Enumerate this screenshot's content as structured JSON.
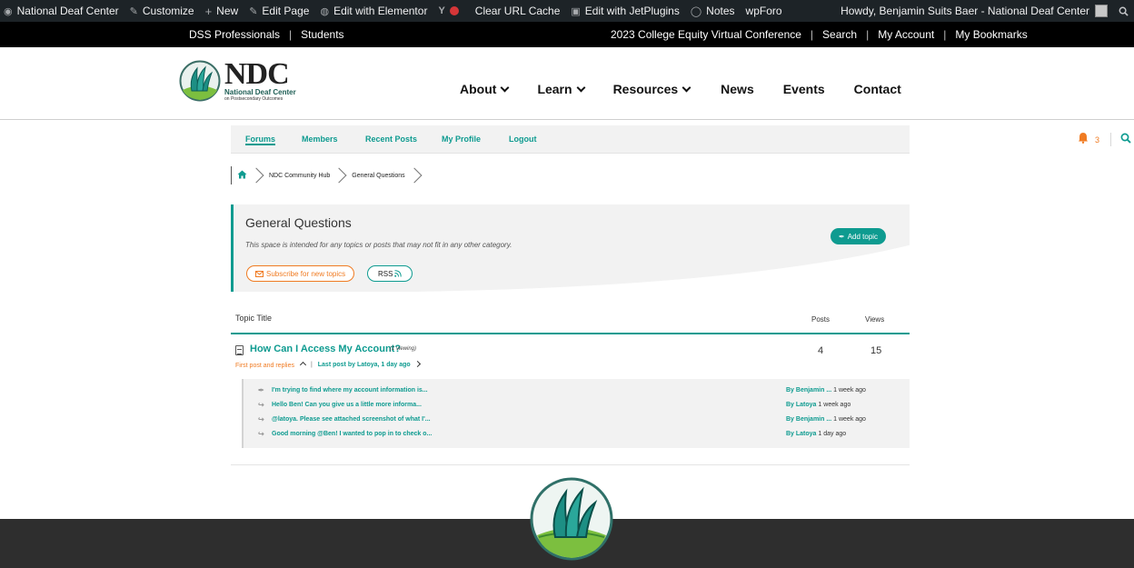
{
  "adminbar": {
    "site_name": "National Deaf Center",
    "customize": "Customize",
    "new": "New",
    "edit_page": "Edit Page",
    "edit_elementor": "Edit with Elementor",
    "yoast": "Y",
    "clear_cache": "Clear URL Cache",
    "jet": "Edit with JetPlugins",
    "notes": "Notes",
    "wpforo": "wpForo",
    "howdy": "Howdy, Benjamin Suits Baer - National Deaf Center"
  },
  "topbar": {
    "left": [
      "DSS Professionals",
      "Students"
    ],
    "right": [
      "2023 College Equity Virtual Conference",
      "Search",
      "My Account",
      "My Bookmarks"
    ]
  },
  "logo": {
    "big": "NDC",
    "sub": "National Deaf Center",
    "sub2": "on Postsecondary Outcomes"
  },
  "mainnav": {
    "about": "About",
    "learn": "Learn",
    "resources": "Resources",
    "news": "News",
    "events": "Events",
    "contact": "Contact"
  },
  "forumnav": {
    "items": [
      "Forums",
      "Members",
      "Recent Posts",
      "My Profile",
      "Logout"
    ],
    "notifications": "3"
  },
  "breadcrumb": {
    "items": [
      "NDC Community Hub",
      "General Questions"
    ]
  },
  "forum": {
    "title": "General Questions",
    "description": "This space is intended for any topics or posts that may not fit in any other category.",
    "subscribe": "Subscribe for new topics",
    "rss": "RSS",
    "add_topic": "Add topic"
  },
  "table": {
    "header_title": "Topic Title",
    "header_posts": "Posts",
    "header_views": "Views"
  },
  "topic": {
    "title": "How Can I Access My Account?",
    "viewing": "(1 viewing)",
    "posts": "4",
    "views": "15",
    "first_post": "First post and replies",
    "last_post": "Last post by Latoya, 1 day ago"
  },
  "replies": [
    {
      "text": "I'm trying to find where my account information is...",
      "author": "By Benjamin ...",
      "time": "1 week ago"
    },
    {
      "text": "Hello Ben! Can you give us a little more informa...",
      "author": "By Latoya",
      "time": "1 week ago"
    },
    {
      "text": "@latoya. Please see attached screenshot of what I'...",
      "author": "By Benjamin ...",
      "time": "1 week ago"
    },
    {
      "text": "Good morning @Ben! I wanted to pop in to check o...",
      "author": "By Latoya",
      "time": "1 day ago"
    }
  ],
  "colors": {
    "teal": "#0e9b90",
    "orange": "#f07b22",
    "admin_bar": "#1d2327",
    "footer": "#2e2e2e"
  }
}
